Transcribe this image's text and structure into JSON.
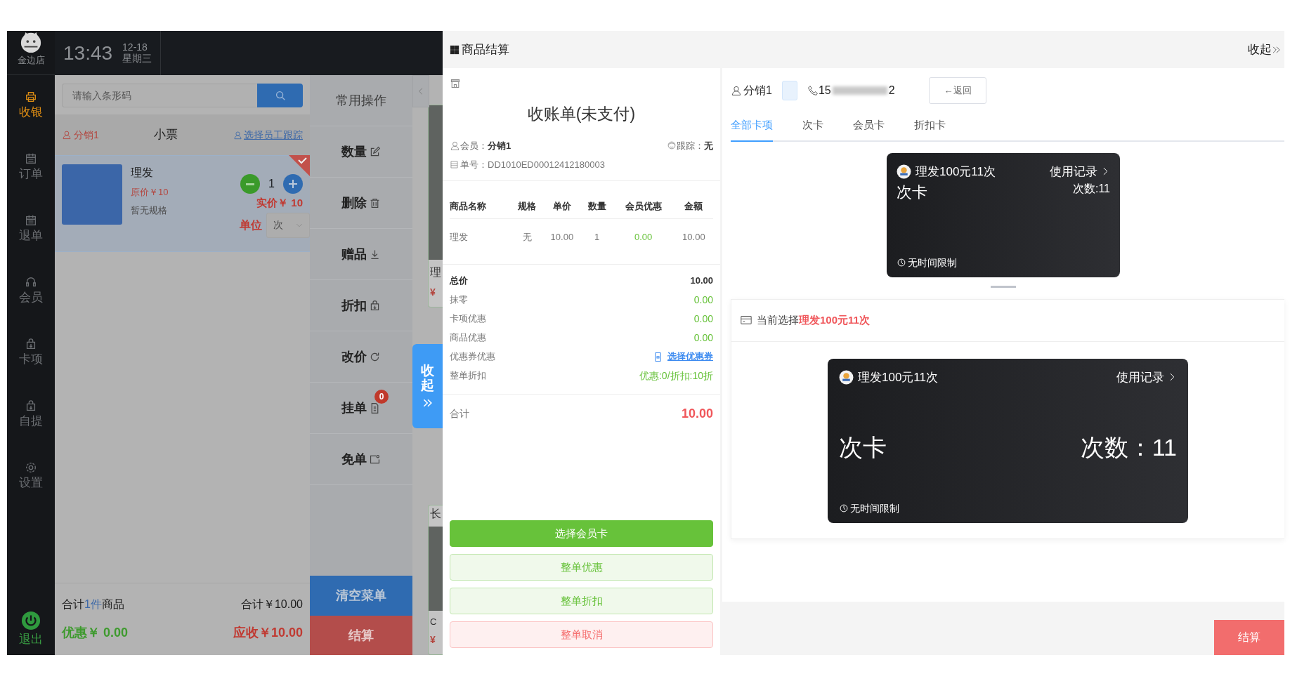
{
  "sidebar": {
    "store_name": "金边店",
    "items": [
      {
        "label": "收银",
        "kind": "printer",
        "selected": true
      },
      {
        "label": "订单",
        "kind": "calendar",
        "selected": false
      },
      {
        "label": "退单",
        "kind": "calendar",
        "selected": false
      },
      {
        "label": "会员",
        "kind": "headset",
        "selected": false
      },
      {
        "label": "卡项",
        "kind": "bag",
        "selected": false
      },
      {
        "label": "自提",
        "kind": "bag",
        "selected": false
      },
      {
        "label": "设置",
        "kind": "gear",
        "selected": false
      }
    ],
    "logout": "退出"
  },
  "header": {
    "time": "13:43",
    "date": "12-18",
    "weekday": "星期三"
  },
  "search": {
    "placeholder": "请输入条形码"
  },
  "ticket": {
    "member": "分销1",
    "title": "小票",
    "staff_link": "选择员工跟踪"
  },
  "cart_items": [
    {
      "name": "理发",
      "original_price": "原价￥10",
      "spec": "暂无规格",
      "quantity": "1",
      "actual_price": "实价￥ 10",
      "unit_label": "单位",
      "unit": "次",
      "selected": true
    }
  ],
  "cart_footer": {
    "count_prefix": "合计",
    "count": "1件",
    "count_suffix": "商品",
    "total": "合计￥10.00",
    "discount": "优惠￥ 0.00",
    "receivable": "应收￥10.00"
  },
  "operations": {
    "title": "常用操作",
    "items": [
      {
        "label": "数量",
        "kind": "edit"
      },
      {
        "label": "删除",
        "kind": "trash"
      },
      {
        "label": "赠品",
        "kind": "download"
      },
      {
        "label": "折扣",
        "kind": "bag"
      },
      {
        "label": "改价",
        "kind": "refresh"
      },
      {
        "label": "挂单",
        "kind": "doc",
        "badge": "0"
      },
      {
        "label": "免单",
        "kind": "ticket"
      }
    ],
    "clear_button": "清空菜单",
    "checkout_button": "结算"
  },
  "product_strip": [
    {
      "lines": [
        {
          "kind": "image"
        },
        {
          "kind": "title",
          "text": "理"
        },
        {
          "kind": "price",
          "text": "¥"
        }
      ]
    },
    {
      "lines": [
        {
          "kind": "title",
          "text": "长"
        },
        {
          "kind": "image"
        },
        {
          "kind": "code",
          "text": "C"
        },
        {
          "kind": "price",
          "text": "¥"
        }
      ]
    }
  ],
  "collapse_tab": {
    "label": "收起"
  },
  "checkout": {
    "title": "商品结算",
    "receipt_title": "收账单(未支付)",
    "member": "会员：**分销1**",
    "tracker": "跟踪：**无**",
    "order_no": "单号：DD1010ED00012412180003",
    "columns": [
      "商品名称",
      "规格",
      "单价",
      "数量",
      "会员优惠",
      "金额"
    ],
    "rows": [
      [
        "理发",
        "无",
        "10.00",
        "1",
        "0.00",
        "10.00"
      ]
    ],
    "summary": [
      {
        "label": "总价",
        "value": "10.00",
        "kind": "total"
      },
      {
        "label": "抹零",
        "value": "0.00",
        "kind": "discount"
      },
      {
        "label": "卡项优惠",
        "value": "0.00",
        "kind": "discount"
      },
      {
        "label": "商品优惠",
        "value": "0.00",
        "kind": "discount"
      },
      {
        "label": "优惠券优惠",
        "value": "选择优惠券",
        "kind": "link"
      },
      {
        "label": "整单折扣",
        "value": "优惠:0/折扣:10折",
        "kind": "discount"
      }
    ],
    "grand_total_label": "合计",
    "grand_total": "10.00",
    "actions": [
      {
        "label": "选择会员卡",
        "kind": "primary"
      },
      {
        "label": "整单优惠",
        "kind": "soft"
      },
      {
        "label": "整单折扣",
        "kind": "soft"
      },
      {
        "label": "整单取消",
        "kind": "danger"
      }
    ]
  },
  "cards_panel": {
    "collapse": "收起",
    "member": "分销1",
    "phone_start": "15",
    "phone_end": "2",
    "back": "←返回",
    "tabs": [
      {
        "label": "全部卡项",
        "selected": true
      },
      {
        "label": "次卡",
        "selected": false
      },
      {
        "label": "会员卡",
        "selected": false
      },
      {
        "label": "折扣卡",
        "selected": false
      }
    ],
    "cards": [
      {
        "name": "理发100元11次",
        "history": "使用记录",
        "type": "次卡",
        "count": "次数:11",
        "validity": "无时间限制"
      }
    ],
    "current_label": "当前选择",
    "current_name": "理发100元11次",
    "selected_card": {
      "name": "理发100元11次",
      "history": "使用记录",
      "type": "次卡",
      "count": "次数：11",
      "validity": "无时间限制"
    },
    "checkout": "结算"
  }
}
